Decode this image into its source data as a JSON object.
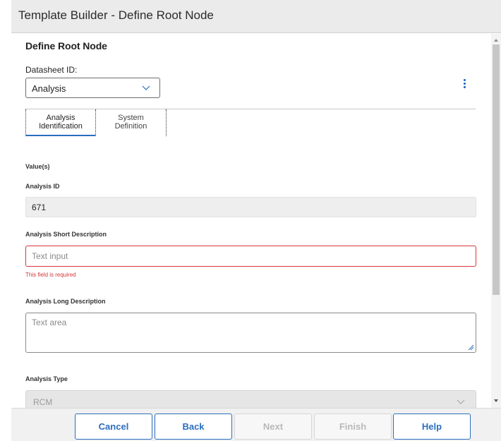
{
  "window": {
    "title": "Template Builder - Define Root Node"
  },
  "section": {
    "title": "Define Root Node"
  },
  "datasheet": {
    "label": "Datasheet ID:",
    "selected": "Analysis"
  },
  "tabs": [
    {
      "line1": "Analysis",
      "line2": "Identification",
      "active": true
    },
    {
      "line1": "System",
      "line2": "Definition",
      "active": false
    }
  ],
  "form": {
    "values_heading": "Value(s)",
    "analysis_id": {
      "label": "Analysis ID",
      "value": "671"
    },
    "short_description": {
      "label": "Analysis Short Description",
      "placeholder": "Text input",
      "error": "This field is required"
    },
    "long_description": {
      "label": "Analysis Long Description",
      "placeholder": "Text area"
    },
    "analysis_type": {
      "label": "Analysis Type",
      "value": "RCM"
    }
  },
  "footer": {
    "cancel": "Cancel",
    "back": "Back",
    "next": "Next",
    "finish": "Finish",
    "help": "Help"
  },
  "colors": {
    "accent": "#2a6ebf",
    "error": "#d6353a",
    "titlebar": "#ebebeb"
  },
  "icons": [
    "chevron-down-icon",
    "kebab-menu-icon",
    "resize-grip-icon",
    "scroll-up-icon",
    "scroll-down-icon"
  ]
}
